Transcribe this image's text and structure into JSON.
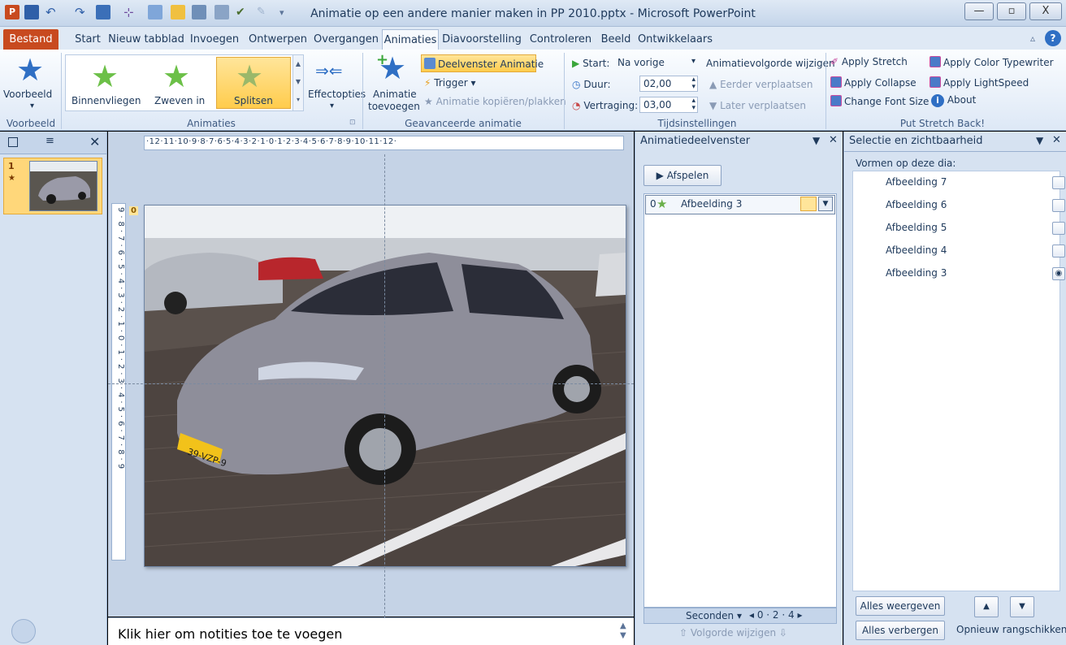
{
  "window": {
    "title": "Animatie op een andere manier maken in PP 2010.pptx - Microsoft PowerPoint",
    "minimize": "—",
    "maximize": "▫",
    "close": "X"
  },
  "tabs": {
    "file": "Bestand",
    "start": "Start",
    "new": "Nieuw tabblad",
    "insert": "Invoegen",
    "design": "Ontwerpen",
    "transitions": "Overgangen",
    "animations": "Animaties",
    "slideshow": "Diavoorstelling",
    "review": "Controleren",
    "view": "Beeld",
    "developer": "Ontwikkelaars"
  },
  "ribbon": {
    "preview": {
      "label": "Voorbeeld",
      "group": "Voorbeeld"
    },
    "animations": {
      "fly_in": "Binnenvliegen",
      "float_in": "Zweven in",
      "split": "Splitsen",
      "effect_options": "Effectopties",
      "group": "Animaties"
    },
    "advanced": {
      "add_animation_1": "Animatie",
      "add_animation_2": "toevoegen",
      "pane": "Deelvenster Animatie",
      "trigger": "Trigger",
      "painter": "Animatie kopiëren/plakken",
      "group": "Geavanceerde animatie"
    },
    "timing": {
      "start_label": "Start:",
      "start_value": "Na vorige",
      "duration_label": "Duur:",
      "duration_value": "02,00",
      "delay_label": "Vertraging:",
      "delay_value": "03,00",
      "reorder": "Animatievolgorde wijzigen",
      "move_earlier": "Eerder verplaatsen",
      "move_later": "Later verplaatsen",
      "group": "Tijdsinstellingen"
    },
    "addin": {
      "stretch": "Apply Stretch",
      "typewriter": "Apply Color Typewriter",
      "collapse": "Apply Collapse",
      "lightspeed": "Apply LightSpeed",
      "font": "Change Font Size",
      "about": "About",
      "group": "Put Stretch Back!"
    }
  },
  "thumbs": {
    "slide_no": "1"
  },
  "ruler": {
    "h": "·12·11·10·9·8·7·6·5·4·3·2·1·0·1·2·3·4·5·6·7·8·9·10·11·12·",
    "v": "9·8·7·6·5·4·3·2·1·0·1·2·3·4·5·6·7·8·9"
  },
  "slide": {
    "tag": "0",
    "plate": "39-VZP-9"
  },
  "anim_pane": {
    "title": "Animatiedeelvenster",
    "play": "Afspelen",
    "item_no": "0",
    "item": "Afbeelding 3",
    "seconds": "Seconden",
    "timeline": "0 · 2 · 4",
    "reorder": "Volgorde wijzigen"
  },
  "sel_pane": {
    "title": "Selectie en zichtbaarheid",
    "subtitle": "Vormen op deze dia:",
    "items": [
      "Afbeelding 7",
      "Afbeelding 6",
      "Afbeelding 5",
      "Afbeelding 4",
      "Afbeelding 3"
    ],
    "show_all": "Alles weergeven",
    "hide_all": "Alles verbergen",
    "reorder": "Opnieuw rangschikken"
  },
  "notes": {
    "placeholder": "Klik hier om notities toe te voegen"
  }
}
